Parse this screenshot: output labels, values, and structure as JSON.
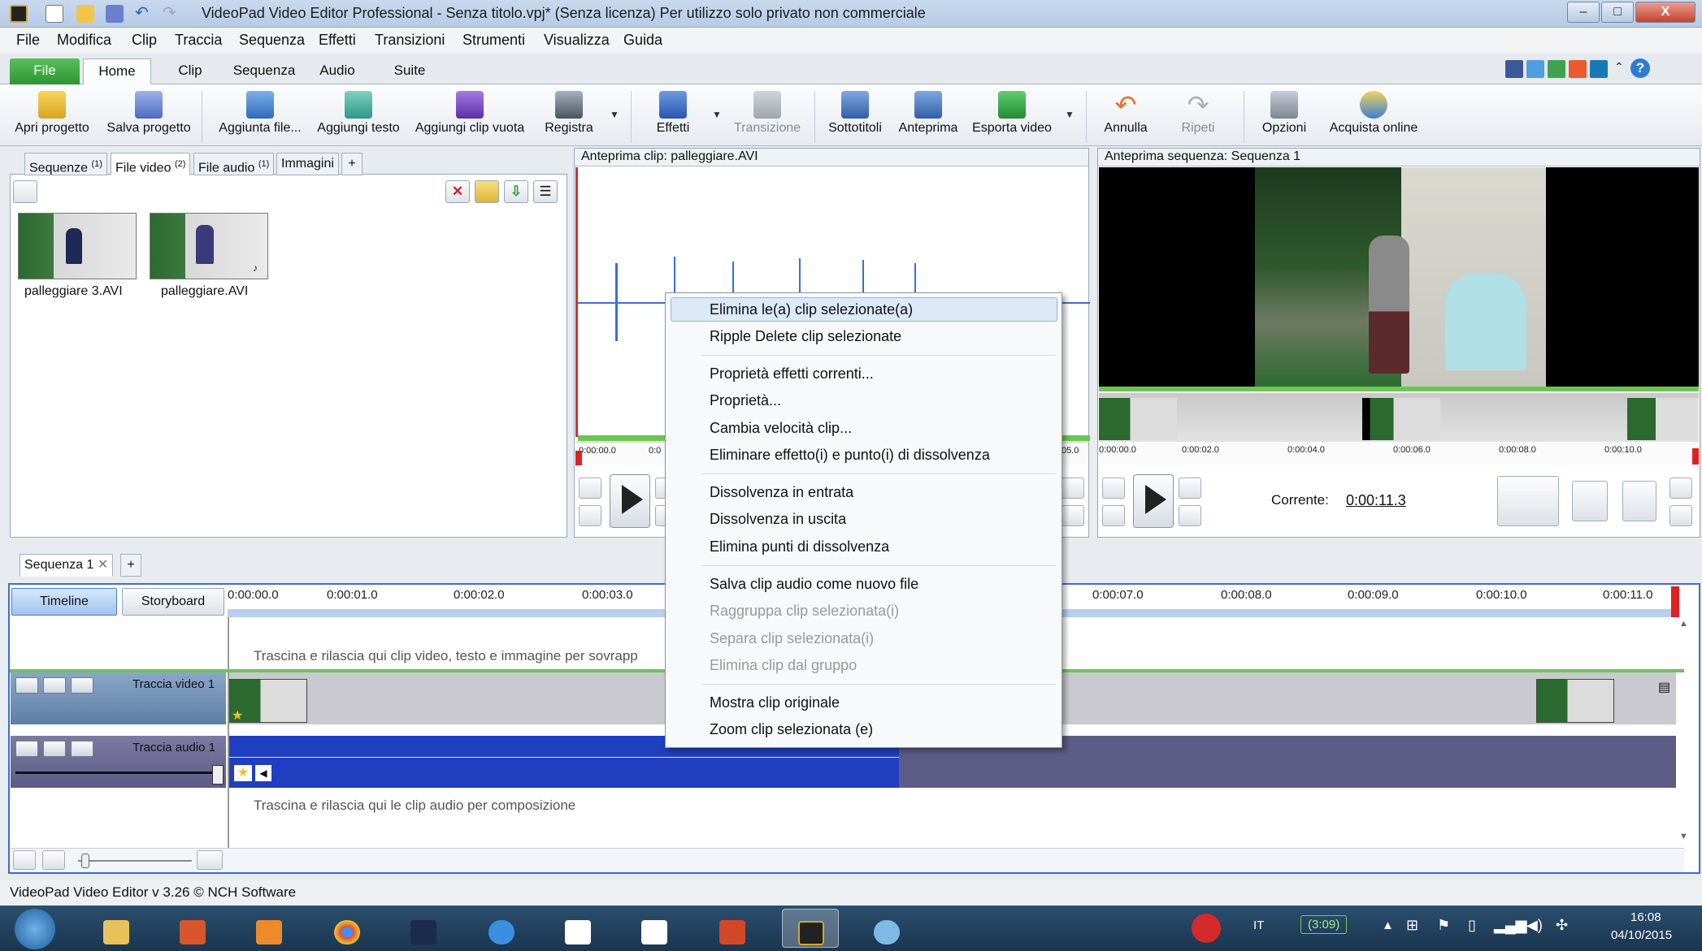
{
  "window": {
    "title": "VideoPad Video Editor Professional - Senza titolo.vpj* (Senza licenza) Per utilizzo solo privato non commerciale",
    "minimize": "–",
    "maximize": "□",
    "close": "X"
  },
  "menubar": [
    "File",
    "Modifica",
    "Clip",
    "Traccia",
    "Sequenza",
    "Effetti",
    "Transizioni",
    "Strumenti",
    "Visualizza",
    "Guida"
  ],
  "ribbon_tabs": [
    "File",
    "Home",
    "Clip",
    "Sequenza",
    "Audio",
    "Suite"
  ],
  "ribbon_buttons": {
    "apri_progetto": "Apri progetto",
    "salva_progetto": "Salva progetto",
    "aggiunta_file": "Aggiunta file...",
    "aggiungi_testo": "Aggiungi testo",
    "aggiungi_clip_vuota": "Aggiungi clip vuota",
    "registra": "Registra",
    "effetti": "Effetti",
    "transizione": "Transizione",
    "sottotitoli": "Sottotitoli",
    "anteprima": "Anteprima",
    "esporta_video": "Esporta video",
    "annulla": "Annulla",
    "ripeti": "Ripeti",
    "opzioni": "Opzioni",
    "acquista_online": "Acquista online"
  },
  "social_icons": [
    "facebook-icon",
    "twitter-icon",
    "google-plus-icon",
    "stumbleupon-icon",
    "linkedin-icon",
    "help-icon"
  ],
  "bin": {
    "tabs": [
      {
        "label": "Sequenze",
        "count": "(1)"
      },
      {
        "label": "File video",
        "count": "(2)"
      },
      {
        "label": "File audio",
        "count": "(1)"
      },
      {
        "label": "Immagini",
        "count": ""
      }
    ],
    "add_tab": "+",
    "files": [
      "palleggiare 3.AVI",
      "palleggiare.AVI"
    ]
  },
  "clip_preview": {
    "title": "Anteprima clip: palleggiare.AVI",
    "ruler_start": "0:00:00.0",
    "ruler_next": "0:0",
    "ruler_end": "05.0"
  },
  "sequence_preview": {
    "title": "Anteprima sequenza: Sequenza 1",
    "ruler": [
      "0:00:00.0",
      "0:00:02.0",
      "0:00:04.0",
      "0:00:06.0",
      "0:00:08.0",
      "0:00:10.0"
    ],
    "current_label": "Corrente:",
    "current_time": "0:00:11.3"
  },
  "context_menu": {
    "groups": [
      [
        {
          "label": "Elimina le(a) clip selezionate(a)",
          "enabled": true,
          "highlight": true
        },
        {
          "label": "Ripple Delete clip selezionate",
          "enabled": true
        }
      ],
      [
        {
          "label": "Proprietà effetti correnti...",
          "enabled": true
        },
        {
          "label": "Proprietà...",
          "enabled": true
        },
        {
          "label": "Cambia velocità clip...",
          "enabled": true
        },
        {
          "label": "Eliminare effetto(i) e punto(i) di dissolvenza",
          "enabled": true
        }
      ],
      [
        {
          "label": "Dissolvenza in entrata",
          "enabled": true
        },
        {
          "label": "Dissolvenza in uscita",
          "enabled": true
        },
        {
          "label": "Elimina punti di dissolvenza",
          "enabled": true
        }
      ],
      [
        {
          "label": "Salva clip audio come nuovo file",
          "enabled": true
        },
        {
          "label": "Raggruppa clip selezionata(i)",
          "enabled": false
        },
        {
          "label": "Separa clip selezionata(i)",
          "enabled": false
        },
        {
          "label": "Elimina clip dal gruppo",
          "enabled": false
        }
      ],
      [
        {
          "label": "Mostra clip originale",
          "enabled": true
        },
        {
          "label": "Zoom clip selezionata (e)",
          "enabled": true
        }
      ]
    ]
  },
  "timeline": {
    "sequence_tab": "Sequenza 1",
    "sequence_tab_close": "✕",
    "add_tab": "+",
    "view_timeline": "Timeline",
    "view_storyboard": "Storyboard",
    "ruler": [
      "0:00:00.0",
      "0:00:01.0",
      "0:00:02.0",
      "0:00:03.0",
      "0:00:07.0",
      "0:00:08.0",
      "0:00:09.0",
      "0:00:10.0",
      "0:00:11.0"
    ],
    "video_drop_hint": "Trascina e rilascia qui clip video, testo e immagine per sovrapp",
    "video_track_label": "Traccia video 1",
    "audio_track_label": "Traccia audio 1",
    "audio_drop_hint": "Trascina e rilascia qui le clip audio per composizione"
  },
  "statusbar": {
    "text": "VideoPad Video Editor v 3.26 © NCH Software"
  },
  "taskbar": {
    "language": "IT",
    "battery": "(3:09)",
    "time": "16:08",
    "date": "04/10/2015"
  },
  "colors": {
    "accent_green": "#3aa13a",
    "audio_clip_blue": "#1f3fc0",
    "audio_track_purple": "#5c5c86",
    "track_header_blue": "#5d7fa6",
    "menu_highlight": "#dbe9f8"
  }
}
